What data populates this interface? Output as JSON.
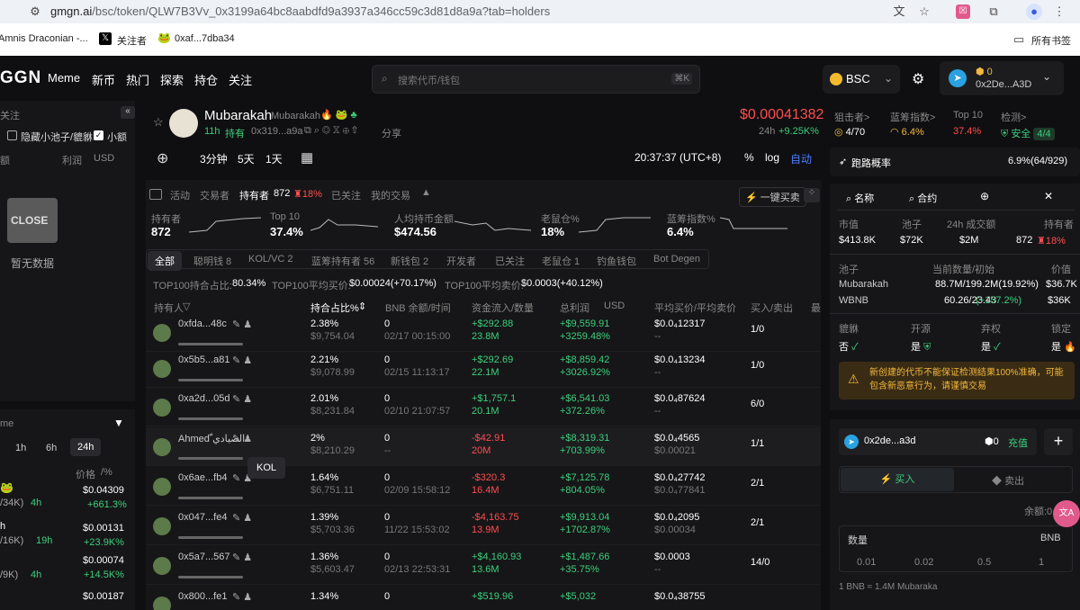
{
  "browser": {
    "url_domain": "gmgn.ai",
    "url_rest": "/bsc/token/QLW7B3Vv_0x3199a64bc8aabdfd9a3937a346cc59c3d81d8a9a?tab=holders",
    "bookmarks": [
      "Amnis Draconian -...",
      "关注者",
      "0xaf...7dba34"
    ],
    "bookmarks_folder": "所有书签"
  },
  "nav": {
    "logo": "GGN",
    "items": [
      "Meme",
      "新币",
      "热门",
      "探索",
      "持仓",
      "关注"
    ],
    "search_placeholder": "搜索代币/钱包",
    "search_kbd": "⌘K",
    "chain": "BSC",
    "wallet_balance": "0",
    "wallet_addr": "0x2De...A3D"
  },
  "left": {
    "header": "关注",
    "hide_small_pool": "隐藏小池子/貔貅",
    "small_amount": "小额",
    "col_amount": "额",
    "col_profit": "利润",
    "col_usd": "USD",
    "close_label": "CLOSE",
    "no_data": "暂无数据",
    "sec2_title": "me",
    "timeframes": [
      "1h",
      "6h",
      "24h"
    ],
    "col_price": "价格",
    "price_sub": "/%",
    "items": [
      {
        "sub": "/34K)",
        "age": "4h",
        "price": "$0.04309",
        "chg": "+661.3%"
      },
      {
        "sub": "/16K)",
        "age": "19h",
        "price": "$0.00131",
        "chg": "+23.9K%"
      },
      {
        "sub": "/9K)",
        "age": "4h",
        "price": "$0.00074",
        "chg": "+14.5K%"
      },
      {
        "sub": "",
        "age": "",
        "price": "$0.00187",
        "chg": ""
      }
    ],
    "first_item_name": "h"
  },
  "token": {
    "name": "Mubarakah",
    "sub_name": "Mubarakah",
    "age": "11h",
    "hold": "持有",
    "addr": "0x319...a9a",
    "share": "分享",
    "price": "$0.00041382",
    "period": "24h",
    "change": "+9.25K%"
  },
  "metrics": {
    "sniper_label": "狙击者>",
    "sniper_val": "4/70",
    "bluechip_label": "蓝筹指数>",
    "bluechip_val": "6.4%",
    "top10_label": "Top 10",
    "top10_val": "37.4%",
    "check_label": "检测>",
    "safe": "安全",
    "safe_val": "4/4"
  },
  "chart_toolbar": {
    "intervals": [
      "3分钟",
      "5天",
      "1天"
    ],
    "time": "20:37:37 (UTC+8)",
    "pct": "%",
    "log": "log",
    "auto": "自动"
  },
  "tabs": {
    "items": [
      "活动",
      "交易者",
      "持有者",
      "已关注",
      "我的交易"
    ],
    "holders_count": "872",
    "holders_pct": "18%",
    "buy_button": "一键买卖"
  },
  "summary": [
    {
      "label": "持有者",
      "value": "872"
    },
    {
      "label": "Top 10",
      "value": "37.4%"
    },
    {
      "label": "人均持币金额",
      "value": "$474.56"
    },
    {
      "label": "老鼠仓%",
      "value": "18%"
    },
    {
      "label": "蓝筹指数%",
      "value": "6.4%"
    }
  ],
  "filters": [
    "全部",
    "聪明钱 8",
    "KOL/VC 2",
    "蓝筹持有者 56",
    "新钱包 2",
    "开发者",
    "已关注",
    "老鼠仓 1",
    "钓鱼钱包",
    "Bot Degen"
  ],
  "top100": {
    "hold_label": "TOP100持合占比:",
    "hold_val": "80.34%",
    "buy_label": "TOP100平均买价:",
    "buy_val": "$0.00024(+70.17%)",
    "sell_label": "TOP100平均卖价:",
    "sell_val": "$0.0003(+40.12%)"
  },
  "table": {
    "headers": [
      "持有人",
      "持合占比%",
      "BNB 余额/时间",
      "资金流入/数量",
      "总利润",
      "USD",
      "平均买价/平均卖价",
      "买入/卖出",
      "最"
    ],
    "rows": [
      {
        "name": "0xfda...48c",
        "pct": "2.38%",
        "pct_sub": "$9,754.04",
        "bnb": "0",
        "time": "02/17 00:15:00",
        "flow": "+$292.88",
        "qty": "23.8M",
        "profit": "+$9,559.91",
        "profit_pct": "+3259.48%",
        "avg": "$0.0₄12317",
        "avg2": "--",
        "bs": "1/0",
        "flow_neg": false
      },
      {
        "name": "0x5b5...a81",
        "pct": "2.21%",
        "pct_sub": "$9,078.99",
        "bnb": "0",
        "time": "02/15 11:13:17",
        "flow": "+$292.69",
        "qty": "22.1M",
        "profit": "+$8,859.42",
        "profit_pct": "+3026.92%",
        "avg": "$0.0₄13234",
        "avg2": "--",
        "bs": "1/0",
        "flow_neg": false
      },
      {
        "name": "0xa2d...05d",
        "pct": "2.01%",
        "pct_sub": "$8,231.84",
        "bnb": "0",
        "time": "02/10 21:07:57",
        "flow": "+$1,757.1",
        "qty": "20.1M",
        "profit": "+$6,541.03",
        "profit_pct": "+372.26%",
        "avg": "$0.0₄87624",
        "avg2": "--",
        "bs": "6/0",
        "flow_neg": false
      },
      {
        "name": "Ahmed ّالصيادي",
        "pct": "2%",
        "pct_sub": "$8,210.29",
        "bnb": "0",
        "time": "--",
        "flow": "-$42.91",
        "qty": "20M",
        "profit": "+$8,319.31",
        "profit_pct": "+703.99%",
        "avg": "$0.0₄4565",
        "avg2": "$0.00021",
        "bs": "1/1",
        "flow_neg": true
      },
      {
        "name": "0x6ae...fb4",
        "pct": "1.64%",
        "pct_sub": "$6,751.11",
        "bnb": "0",
        "time": "02/09 15:58:12",
        "flow": "-$320.3",
        "qty": "16.4M",
        "profit": "+$7,125.78",
        "profit_pct": "+804.05%",
        "avg": "$0.0₄27742",
        "avg2": "$0.0₄77841",
        "bs": "2/1",
        "flow_neg": true
      },
      {
        "name": "0x047...fe4",
        "pct": "1.39%",
        "pct_sub": "$5,703.36",
        "bnb": "0",
        "time": "11/22 15:53:02",
        "flow": "-$4,163.75",
        "qty": "13.9M",
        "profit": "+$9,913.04",
        "profit_pct": "+1702.87%",
        "avg": "$0.0₄2095",
        "avg2": "$0.00034",
        "bs": "2/1",
        "flow_neg": true
      },
      {
        "name": "0x5a7...567",
        "pct": "1.36%",
        "pct_sub": "$5,603.47",
        "bnb": "0",
        "time": "02/13 22:53:31",
        "flow": "+$4,160.93",
        "qty": "13.6M",
        "profit": "+$1,487.66",
        "profit_pct": "+35.75%",
        "avg": "$0.0003",
        "avg2": "--",
        "bs": "14/0",
        "flow_neg": false
      },
      {
        "name": "0x800...fe1",
        "pct": "1.34%",
        "pct_sub": "",
        "bnb": "0",
        "time": "",
        "flow": "+$519.96",
        "qty": "",
        "profit": "+$5,032",
        "profit_pct": "",
        "avg": "$0.0₄38755",
        "avg2": "",
        "bs": "",
        "flow_neg": false
      }
    ],
    "tooltip": "KOL"
  },
  "right": {
    "run_prob_label": "跑路概率",
    "run_prob_val": "6.9%(64/929)",
    "search_name": "名称",
    "search_contract": "合约",
    "stats_labels": [
      "市值",
      "池子",
      "24h 成交额",
      "持有者"
    ],
    "stats_values": [
      "$413.8K",
      "$72K",
      "$2M",
      "872"
    ],
    "holders_pct": "18%",
    "pool_header": [
      "池子",
      "当前数量/初始",
      "价值"
    ],
    "pool_rows": [
      {
        "name": "Mubarakah",
        "qty": "88.7M/199.2M(19.92%)",
        "val": "$36.7K"
      },
      {
        "name": "WBNB",
        "qty": "60.26/23.43",
        "pct": "(+157.2%)",
        "val": "$36K"
      }
    ],
    "flags_labels": [
      "貔貅",
      "开源",
      "弃权",
      "锁定"
    ],
    "flags_values": [
      "否",
      "是",
      "是",
      "是"
    ],
    "warning": "新创建的代币不能保证检测结果100%准确，可能包含新恶意行为，请谨慎交易",
    "wallet": "0x2de...a3d",
    "wallet_bal": "0",
    "recharge": "充值",
    "buy_tab": "买入",
    "sell_tab": "卖出",
    "balance_label": "余额:0",
    "qty_label": "数量",
    "qty_unit": "BNB",
    "qty_presets": [
      "0.01",
      "0.02",
      "0.5",
      "1"
    ],
    "rate": "1 BNB ≈ 1.4M Mubaraka"
  },
  "colors": {
    "green": "#3ccf7c",
    "red": "#ff4d4f",
    "accent": "#4a7dff",
    "bg": "#0f0f11",
    "panel": "#161618"
  }
}
